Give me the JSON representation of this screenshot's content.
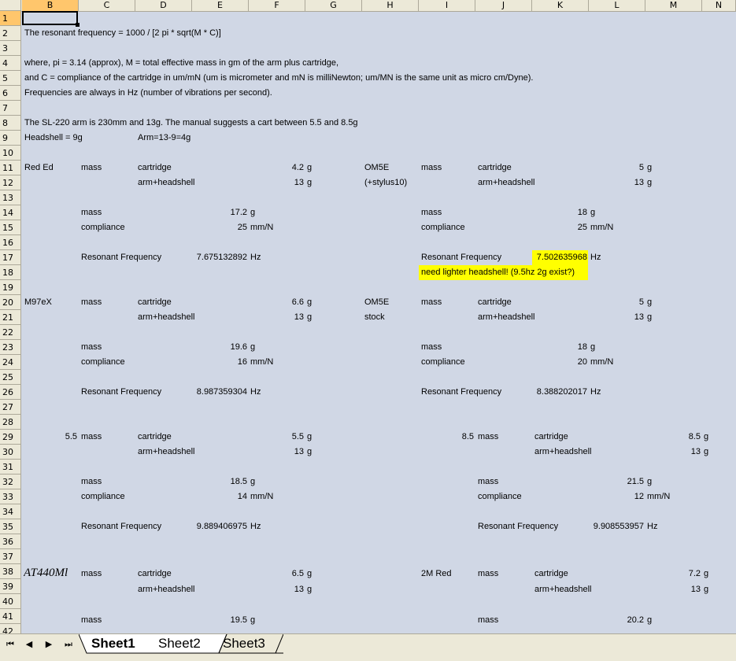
{
  "columns": [
    "B",
    "C",
    "D",
    "E",
    "F",
    "G",
    "H",
    "I",
    "J",
    "K",
    "L",
    "M",
    "N"
  ],
  "rows": [
    "1",
    "2",
    "3",
    "4",
    "5",
    "6",
    "7",
    "8",
    "9",
    "10",
    "11",
    "12",
    "13",
    "14",
    "15",
    "16",
    "17",
    "18",
    "19",
    "20",
    "21",
    "22",
    "23",
    "24",
    "25",
    "26",
    "27",
    "28",
    "29",
    "30",
    "31",
    "32",
    "33",
    "34",
    "35",
    "36",
    "37",
    "38",
    "39",
    "40",
    "41",
    "42"
  ],
  "selected_cell": "B1",
  "cells": {
    "r2": "The resonant frequency = 1000 / [2 pi * sqrt(M * C)]",
    "r4": "where, pi = 3.14 (approx), M = total effective mass in gm of the arm plus cartridge,",
    "r5": "and C = compliance of the cartridge in um/mN (um is micrometer and mN is milliNewton; um/MN is the same unit as micro cm/Dyne).",
    "r6": " Frequencies are always in Hz (number of vibrations per second).",
    "r8": "The SL-220 arm is 230mm and 13g.  The manual suggests a cart between 5.5 and 8.5g",
    "r9_b": "Headshell = 9g",
    "r9_d": "Arm=13-9=4g",
    "b1": {
      "name": "Red Ed",
      "mass": "mass",
      "cartridge": "cartridge",
      "cart_val": "4.2",
      "g": "g",
      "arm": "arm+headshell",
      "arm_val": "13",
      "mass_total": "17.2",
      "compliance": "compliance",
      "comp_val": "25",
      "mmn": "mm/N",
      "rf": "Resonant Frequency",
      "rf_val": "7.675132892",
      "hz": "Hz"
    },
    "b2": {
      "name": "OM5E",
      "name2": "(+stylus10)",
      "mass": "mass",
      "cartridge": "cartridge",
      "cart_val": "5",
      "g": "g",
      "arm": "arm+headshell",
      "arm_val": "13",
      "mass_total": "18",
      "compliance": "compliance",
      "comp_val": "25",
      "mmn": "mm/N",
      "rf": "Resonant Frequency",
      "rf_val": "7.502635968",
      "hz": "Hz",
      "note": "need lighter headshell! (9.5hz 2g exist?)"
    },
    "b3": {
      "name": "M97eX",
      "mass": "mass",
      "cartridge": "cartridge",
      "cart_val": "6.6",
      "g": "g",
      "arm": "arm+headshell",
      "arm_val": "13",
      "mass_total": "19.6",
      "compliance": "compliance",
      "comp_val": "16",
      "mmn": "mm/N",
      "rf": "Resonant Frequency",
      "rf_val": "8.987359304",
      "hz": "Hz"
    },
    "b4": {
      "name": "OM5E",
      "name2": "stock",
      "mass": "mass",
      "cartridge": "cartridge",
      "cart_val": "5",
      "g": "g",
      "arm": "arm+headshell",
      "arm_val": "13",
      "mass_total": "18",
      "compliance": "compliance",
      "comp_val": "20",
      "mmn": "mm/N",
      "rf": "Resonant Frequency",
      "rf_val": "8.388202017",
      "hz": "Hz"
    },
    "b5": {
      "name": "5.5",
      "mass": "mass",
      "cartridge": "cartridge",
      "cart_val": "5.5",
      "g": "g",
      "arm": "arm+headshell",
      "arm_val": "13",
      "mass_total": "18.5",
      "compliance": "compliance",
      "comp_val": "14",
      "mmn": "mm/N",
      "rf": "Resonant Frequency",
      "rf_val": "9.889406975",
      "hz": "Hz"
    },
    "b6": {
      "name": "8.5",
      "mass": "mass",
      "cartridge": "cartridge",
      "cart_val": "8.5",
      "g": "g",
      "arm": "arm+headshell",
      "arm_val": "13",
      "mass_total": "21.5",
      "compliance": "compliance",
      "comp_val": "12",
      "mmn": "mm/N",
      "rf": "Resonant Frequency",
      "rf_val": "9.908553957",
      "hz": "Hz"
    },
    "b7": {
      "name": "AT440Ml",
      "mass": "mass",
      "cartridge": "cartridge",
      "cart_val": "6.5",
      "g": "g",
      "arm": "arm+headshell",
      "arm_val": "13",
      "mass_total": "19.5"
    },
    "b8": {
      "name": "2M Red",
      "mass": "mass",
      "cartridge": "cartridge",
      "cart_val": "7.2",
      "g": "g",
      "arm": "arm+headshell",
      "arm_val": "13",
      "mass_total": "20.2"
    }
  },
  "tabs": [
    "Sheet1",
    "Sheet2",
    "Sheet3"
  ],
  "nav": {
    "first": "⏮",
    "prev": "◀",
    "next": "▶",
    "last": "⏭"
  },
  "colors": {
    "highlight": "#ffff00",
    "header_bg": "#ece9d8",
    "selected_header": "#ffc66c",
    "gridline": "#d0d7e5"
  }
}
